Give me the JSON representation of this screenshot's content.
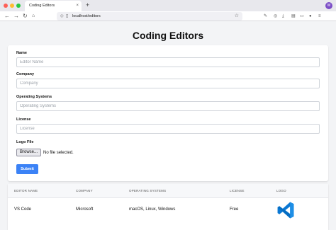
{
  "browser": {
    "tab_title": "Coding Editors",
    "tab_close": "×",
    "new_tab": "+",
    "url": "localhost/editors",
    "profile_initial": "W",
    "back": "←",
    "forward": "→",
    "reload": "↻",
    "star": "☆",
    "colors": {
      "close": "#fe5f57",
      "minimize": "#febc2e",
      "maximize": "#28c840"
    }
  },
  "page": {
    "title": "Coding Editors"
  },
  "form": {
    "fields": [
      {
        "label": "Name",
        "placeholder": "Editor Name"
      },
      {
        "label": "Company",
        "placeholder": "Company"
      },
      {
        "label": "Operating Systems",
        "placeholder": "Operating Systems"
      },
      {
        "label": "License",
        "placeholder": "License"
      }
    ],
    "logo_label": "Logo File",
    "browse_label": "Browse...",
    "file_status": "No file selected.",
    "submit_label": "Submit",
    "accent_color": "#3b82f6"
  },
  "table": {
    "headers": [
      "Editor Name",
      "Company",
      "Operating Systems",
      "License",
      "Logo"
    ],
    "rows": [
      {
        "name": "VS Code",
        "company": "Microsoft",
        "os": "macOS, Linux, Windows",
        "license": "Free",
        "logo_icon": "vscode-logo-icon"
      }
    ]
  }
}
